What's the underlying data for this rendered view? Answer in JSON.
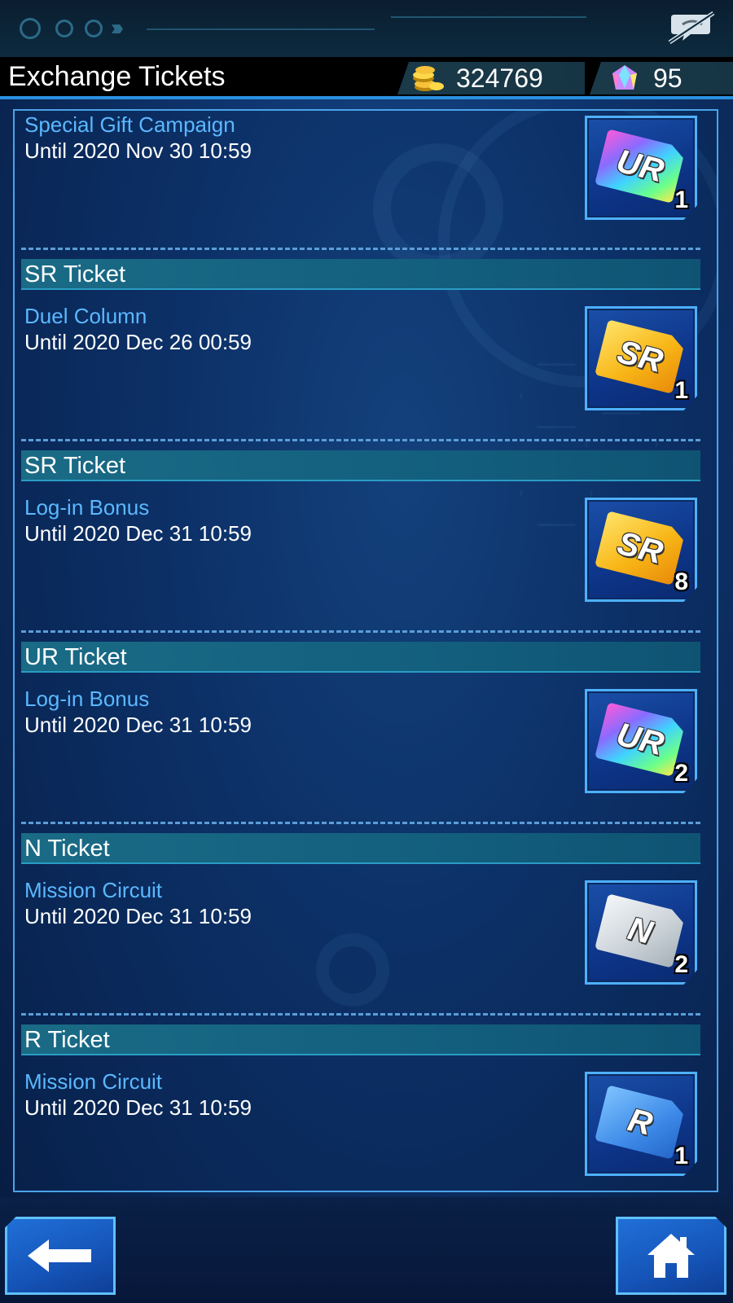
{
  "header": {
    "title": "Exchange Tickets",
    "gold": "324769",
    "gems": "95"
  },
  "entries": [
    {
      "category": "",
      "source": "Special Gift Campaign",
      "until": "Until 2020 Nov 30 10:59",
      "ticket_rarity": "UR",
      "count": "1"
    },
    {
      "category": "SR Ticket",
      "source": "Duel Column",
      "until": "Until 2020 Dec 26 00:59",
      "ticket_rarity": "SR",
      "count": "1"
    },
    {
      "category": "SR Ticket",
      "source": "Log-in Bonus",
      "until": "Until 2020 Dec 31 10:59",
      "ticket_rarity": "SR",
      "count": "8"
    },
    {
      "category": "UR Ticket",
      "source": "Log-in Bonus",
      "until": "Until 2020 Dec 31 10:59",
      "ticket_rarity": "UR",
      "count": "2"
    },
    {
      "category": "N Ticket",
      "source": "Mission Circuit",
      "until": "Until 2020 Dec 31 10:59",
      "ticket_rarity": "N",
      "count": "2"
    },
    {
      "category": "R Ticket",
      "source": "Mission Circuit",
      "until": "Until 2020 Dec 31 10:59",
      "ticket_rarity": "R",
      "count": "1"
    }
  ],
  "icons": {
    "hide_ui": "eye-slash-icon",
    "gold": "gold-coins-icon",
    "gem": "gem-icon",
    "back": "left-arrow-icon",
    "home": "home-icon"
  },
  "colors": {
    "accent": "#4ba3e8",
    "source_text": "#5bb8ff",
    "header_bg": "#1a6b86"
  }
}
